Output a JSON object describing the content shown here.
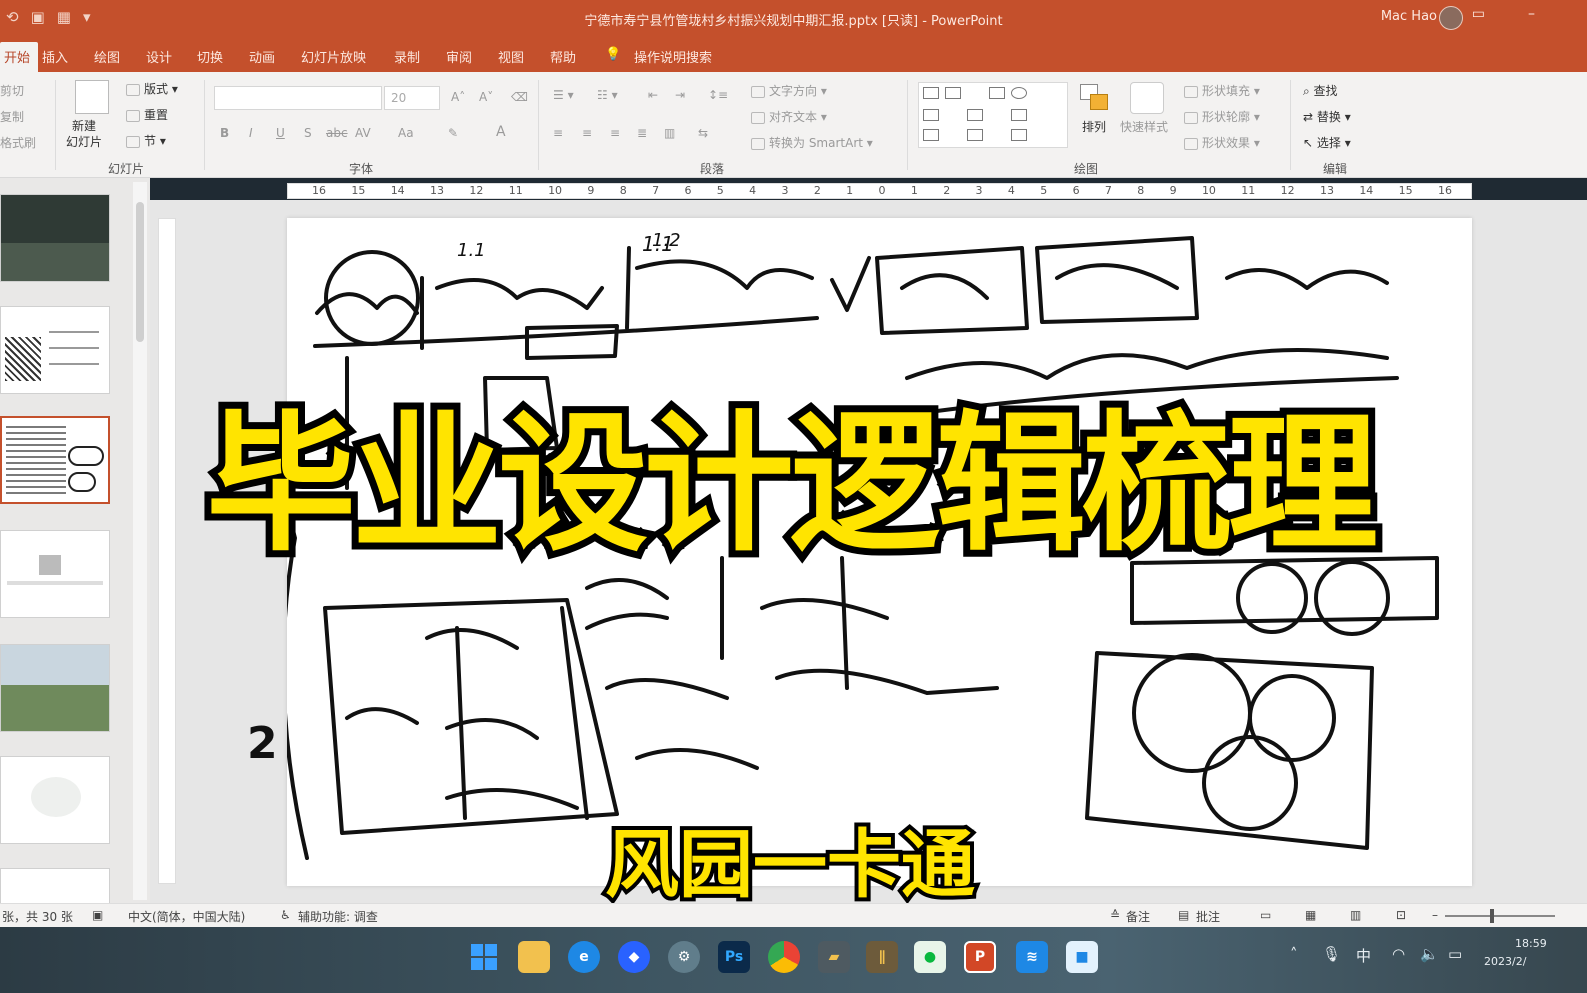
{
  "window": {
    "title": "宁德市寿宁县竹管垅村乡村振兴规划中期汇报.pptx [只读] - PowerPoint",
    "user": "Mac Hao",
    "minimize": "–"
  },
  "ribbon_tabs": [
    {
      "label": "开始",
      "active": true
    },
    {
      "label": "插入"
    },
    {
      "label": "绘图"
    },
    {
      "label": "设计"
    },
    {
      "label": "切换"
    },
    {
      "label": "动画"
    },
    {
      "label": "幻灯片放映"
    },
    {
      "label": "录制"
    },
    {
      "label": "审阅"
    },
    {
      "label": "视图"
    },
    {
      "label": "帮助"
    },
    {
      "label": "操作说明搜索"
    }
  ],
  "ribbon": {
    "clipboard": {
      "cut": "剪切",
      "copy": "复制",
      "format": "格式刷"
    },
    "slides": {
      "new_slide": "新建\n幻灯片",
      "layout": "版式",
      "reset": "重置",
      "section": "节",
      "group_label": "幻灯片"
    },
    "font": {
      "size": "20",
      "group_label": "字体",
      "buttons": [
        "B",
        "I",
        "U",
        "S",
        "abc",
        "AV",
        "Aa",
        "A"
      ]
    },
    "paragraph": {
      "text_direction": "文字方向",
      "align_text": "对齐文本",
      "smartart": "转换为 SmartArt",
      "group_label": "段落"
    },
    "drawing": {
      "arrange": "排列",
      "quick_styles": "快速样式",
      "shape_fill": "形状填充",
      "shape_outline": "形状轮廓",
      "shape_effects": "形状效果",
      "group_label": "绘图"
    },
    "editing": {
      "find": "查找",
      "replace": "替换",
      "select": "选择",
      "group_label": "编辑"
    }
  },
  "ruler_labels": [
    "16",
    "15",
    "14",
    "13",
    "12",
    "11",
    "10",
    "9",
    "8",
    "7",
    "6",
    "5",
    "4",
    "3",
    "2",
    "1",
    "0",
    "1",
    "2",
    "3",
    "4",
    "5",
    "6",
    "7",
    "8",
    "9",
    "10",
    "11",
    "12",
    "13",
    "14",
    "15",
    "16"
  ],
  "slide": {
    "handwriting": [
      "1.1",
      "1.2",
      "2"
    ]
  },
  "overlay": {
    "title": "毕业设计逻辑梳理",
    "subtitle": "风园一卡通"
  },
  "statusbar": {
    "slide_count": "张，共 30 张",
    "language": "中文(简体，中国大陆)",
    "accessibility": "辅助功能: 调查",
    "notes": "备注",
    "comments": "批注"
  },
  "taskbar": {
    "apps": [
      "start",
      "file-explorer",
      "edge",
      "app-blue",
      "settings",
      "Ps",
      "chrome",
      "app-folder",
      "app-stripes",
      "wechat",
      "powerpoint",
      "app-blue-2",
      "app-square"
    ],
    "ime": "中",
    "time": "18:59",
    "date": "2023/2/"
  },
  "colors": {
    "accent": "#c4502c",
    "title_fill": "#ffe400"
  }
}
